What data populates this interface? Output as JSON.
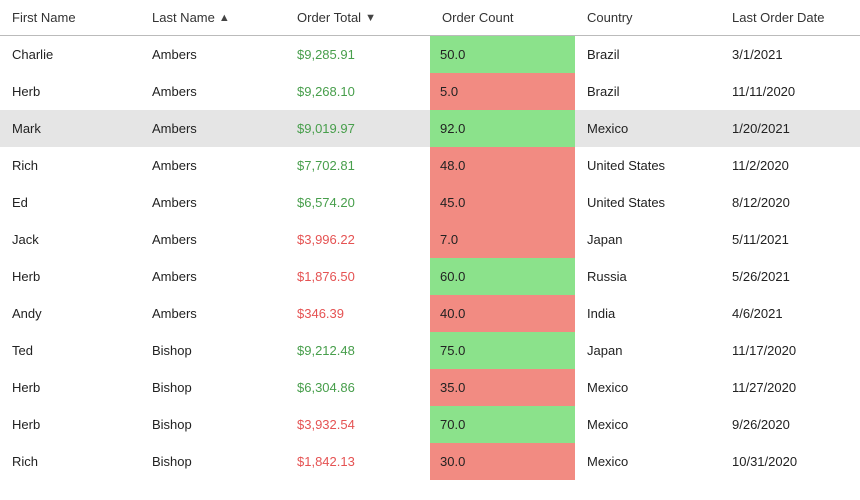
{
  "columns": {
    "first_name": {
      "label": "First Name",
      "sort": null
    },
    "last_name": {
      "label": "Last Name",
      "sort": "asc"
    },
    "order_total": {
      "label": "Order Total",
      "sort": "desc"
    },
    "order_count": {
      "label": "Order Count",
      "sort": null
    },
    "country": {
      "label": "Country",
      "sort": null
    },
    "last_order": {
      "label": "Last Order Date",
      "sort": null
    }
  },
  "order_total_format_threshold": 5000,
  "order_count_format_threshold": 50,
  "rows": [
    {
      "first_name": "Charlie",
      "last_name": "Ambers",
      "order_total_text": "$9,285.91",
      "order_total_value": 9285.91,
      "order_count_text": "50.0",
      "order_count_value": 50,
      "country": "Brazil",
      "last_order": "3/1/2021",
      "highlight": false
    },
    {
      "first_name": "Herb",
      "last_name": "Ambers",
      "order_total_text": "$9,268.10",
      "order_total_value": 9268.1,
      "order_count_text": "5.0",
      "order_count_value": 5,
      "country": "Brazil",
      "last_order": "11/11/2020",
      "highlight": false
    },
    {
      "first_name": "Mark",
      "last_name": "Ambers",
      "order_total_text": "$9,019.97",
      "order_total_value": 9019.97,
      "order_count_text": "92.0",
      "order_count_value": 92,
      "country": "Mexico",
      "last_order": "1/20/2021",
      "highlight": true
    },
    {
      "first_name": "Rich",
      "last_name": "Ambers",
      "order_total_text": "$7,702.81",
      "order_total_value": 7702.81,
      "order_count_text": "48.0",
      "order_count_value": 48,
      "country": "United States",
      "last_order": "11/2/2020",
      "highlight": false
    },
    {
      "first_name": "Ed",
      "last_name": "Ambers",
      "order_total_text": "$6,574.20",
      "order_total_value": 6574.2,
      "order_count_text": "45.0",
      "order_count_value": 45,
      "country": "United States",
      "last_order": "8/12/2020",
      "highlight": false
    },
    {
      "first_name": "Jack",
      "last_name": "Ambers",
      "order_total_text": "$3,996.22",
      "order_total_value": 3996.22,
      "order_count_text": "7.0",
      "order_count_value": 7,
      "country": "Japan",
      "last_order": "5/11/2021",
      "highlight": false
    },
    {
      "first_name": "Herb",
      "last_name": "Ambers",
      "order_total_text": "$1,876.50",
      "order_total_value": 1876.5,
      "order_count_text": "60.0",
      "order_count_value": 60,
      "country": "Russia",
      "last_order": "5/26/2021",
      "highlight": false
    },
    {
      "first_name": "Andy",
      "last_name": "Ambers",
      "order_total_text": "$346.39",
      "order_total_value": 346.39,
      "order_count_text": "40.0",
      "order_count_value": 40,
      "country": "India",
      "last_order": "4/6/2021",
      "highlight": false
    },
    {
      "first_name": "Ted",
      "last_name": "Bishop",
      "order_total_text": "$9,212.48",
      "order_total_value": 9212.48,
      "order_count_text": "75.0",
      "order_count_value": 75,
      "country": "Japan",
      "last_order": "11/17/2020",
      "highlight": false
    },
    {
      "first_name": "Herb",
      "last_name": "Bishop",
      "order_total_text": "$6,304.86",
      "order_total_value": 6304.86,
      "order_count_text": "35.0",
      "order_count_value": 35,
      "country": "Mexico",
      "last_order": "11/27/2020",
      "highlight": false
    },
    {
      "first_name": "Herb",
      "last_name": "Bishop",
      "order_total_text": "$3,932.54",
      "order_total_value": 3932.54,
      "order_count_text": "70.0",
      "order_count_value": 70,
      "country": "Mexico",
      "last_order": "9/26/2020",
      "highlight": false
    },
    {
      "first_name": "Rich",
      "last_name": "Bishop",
      "order_total_text": "$1,842.13",
      "order_total_value": 1842.13,
      "order_count_text": "30.0",
      "order_count_value": 30,
      "country": "Mexico",
      "last_order": "10/31/2020",
      "highlight": false
    }
  ],
  "chart_data": {
    "type": "table",
    "title": "",
    "columns": [
      "First Name",
      "Last Name",
      "Order Total",
      "Order Count",
      "Country",
      "Last Order Date"
    ],
    "records": [
      [
        "Charlie",
        "Ambers",
        9285.91,
        50,
        "Brazil",
        "3/1/2021"
      ],
      [
        "Herb",
        "Ambers",
        9268.1,
        5,
        "Brazil",
        "11/11/2020"
      ],
      [
        "Mark",
        "Ambers",
        9019.97,
        92,
        "Mexico",
        "1/20/2021"
      ],
      [
        "Rich",
        "Ambers",
        7702.81,
        48,
        "United States",
        "11/2/2020"
      ],
      [
        "Ed",
        "Ambers",
        6574.2,
        45,
        "United States",
        "8/12/2020"
      ],
      [
        "Jack",
        "Ambers",
        3996.22,
        7,
        "Japan",
        "5/11/2021"
      ],
      [
        "Herb",
        "Ambers",
        1876.5,
        60,
        "Russia",
        "5/26/2021"
      ],
      [
        "Andy",
        "Ambers",
        346.39,
        40,
        "India",
        "4/6/2021"
      ],
      [
        "Ted",
        "Bishop",
        9212.48,
        75,
        "Japan",
        "11/17/2020"
      ],
      [
        "Herb",
        "Bishop",
        6304.86,
        35,
        "Mexico",
        "11/27/2020"
      ],
      [
        "Herb",
        "Bishop",
        3932.54,
        70,
        "Mexico",
        "9/26/2020"
      ],
      [
        "Rich",
        "Bishop",
        1842.13,
        30,
        "Mexico",
        "10/31/2020"
      ]
    ],
    "conditional_formatting": {
      "Order Total": {
        "rule": ">= 5000 green text, else red text"
      },
      "Order Count": {
        "rule": ">= 50 green fill, else red fill"
      }
    }
  }
}
